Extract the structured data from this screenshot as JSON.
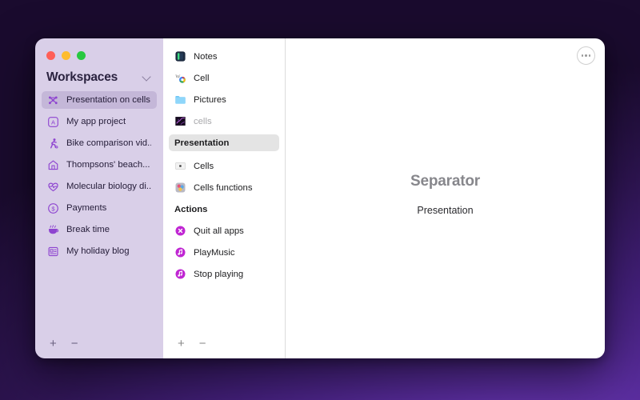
{
  "window": {
    "traffic_lights": [
      {
        "name": "close",
        "color": "#ff5f57"
      },
      {
        "name": "minimize",
        "color": "#febc2e"
      },
      {
        "name": "maximize",
        "color": "#28c840"
      }
    ]
  },
  "sidebar": {
    "title": "Workspaces",
    "chevron_icon": "chevron-down-icon",
    "items": [
      {
        "label": "Presentation on cells",
        "icon": "node-graph-icon",
        "selected": true
      },
      {
        "label": "My app project",
        "icon": "letter-a-box-icon",
        "selected": false
      },
      {
        "label": "Bike comparison vid...",
        "icon": "runner-icon",
        "selected": false
      },
      {
        "label": "Thompsons' beach...",
        "icon": "house-icon",
        "selected": false
      },
      {
        "label": "Molecular biology di...",
        "icon": "heart-pulse-icon",
        "selected": false
      },
      {
        "label": "Payments",
        "icon": "dollar-circle-icon",
        "selected": false
      },
      {
        "label": "Break time",
        "icon": "hot-drink-icon",
        "selected": false
      },
      {
        "label": "My holiday blog",
        "icon": "news-card-icon",
        "selected": false
      }
    ],
    "footer": {
      "add_label": "+",
      "remove_label": "−"
    }
  },
  "middle": {
    "items": [
      {
        "label": "Notes",
        "icon": "notes-app-icon",
        "type": "item",
        "muted": false
      },
      {
        "label": "Cell",
        "icon": "chrome-bookmark-icon",
        "type": "item",
        "muted": false
      },
      {
        "label": "Pictures",
        "icon": "folder-icon",
        "type": "item",
        "muted": false
      },
      {
        "label": "cells",
        "icon": "image-thumbnail-icon",
        "type": "item",
        "muted": true
      },
      {
        "label": "Presentation",
        "icon": "none",
        "type": "header",
        "muted": false
      },
      {
        "label": "Cells",
        "icon": "numbers-app-icon",
        "type": "item",
        "muted": false
      },
      {
        "label": "Cells functions",
        "icon": "shortcut-app-icon",
        "type": "item",
        "muted": false
      },
      {
        "label": "Actions",
        "icon": "none",
        "type": "section",
        "muted": false
      },
      {
        "label": "Quit all apps",
        "icon": "quit-circle-icon",
        "type": "item",
        "muted": false
      },
      {
        "label": "PlayMusic",
        "icon": "music-note-circle-icon",
        "type": "item",
        "muted": false
      },
      {
        "label": "Stop playing",
        "icon": "music-note-circle-icon",
        "type": "item",
        "muted": false
      }
    ],
    "footer": {
      "add_label": "+",
      "remove_label": "−"
    }
  },
  "detail": {
    "more_icon": "ellipsis-circle-icon",
    "title": "Separator",
    "subtitle": "Presentation"
  },
  "colors": {
    "sidebar_bg": "#d9cfe8",
    "sidebar_selected": "#c4b7d8",
    "accent_purple": "#8e44d0",
    "middle_header_bg": "#e4e4e4",
    "desktop_gradient_from": "#190a2c",
    "desktop_gradient_to": "#6a37b0"
  }
}
